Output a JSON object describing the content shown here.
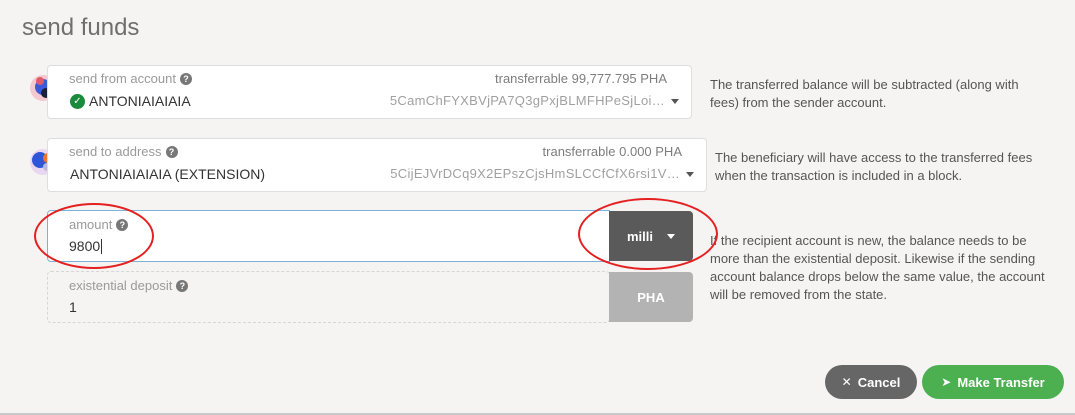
{
  "title": "send funds",
  "send_from": {
    "label": "send from account",
    "balance": "transferrable 99,777.795 PHA",
    "name": "ANTONIAIAIAIA",
    "address": "5CamChFYXBVjPA7Q3gPxjBLMFHPeSjLoi…",
    "help": "The transferred balance will be subtracted (along with fees) from the sender account."
  },
  "send_to": {
    "label": "send to address",
    "balance": "transferrable 0.000 PHA",
    "name": "ANTONIAIAIAIA (EXTENSION)",
    "address": "5CijEJVrDCq9X2EPszCjsHmSLCCfCfX6rsi1V…",
    "help": "The beneficiary will have access to the transferred fees when the transaction is included in a block."
  },
  "amount": {
    "label": "amount",
    "value": "9800",
    "unit": "milli"
  },
  "existential_deposit": {
    "label": "existential deposit",
    "value": "1",
    "unit": "PHA"
  },
  "amount_help": "If the recipient account is new, the balance needs to be more than the existential deposit. Likewise if the sending account balance drops below the same value, the account will be removed from the state.",
  "buttons": {
    "cancel": "Cancel",
    "transfer": "Make Transfer"
  },
  "colors": {
    "unit_dropdown": "#5a5a5a",
    "unit_static": "#b3b3b3",
    "cancel": "#666666",
    "transfer": "#4caf50",
    "highlight": "#e42020"
  }
}
